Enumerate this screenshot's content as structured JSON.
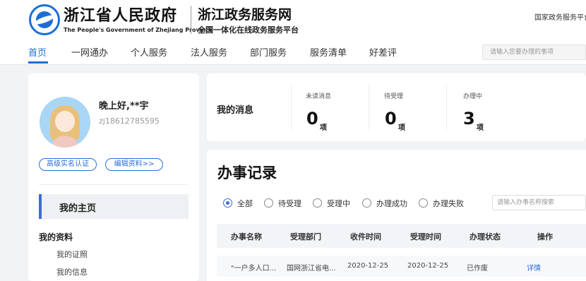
{
  "header": {
    "gov_name_cn": "浙江省人民政府",
    "gov_name_en": "The People's Government of Zhejiang Province",
    "site_name": "浙江政务服务网",
    "site_subtitle": "全国一体化在线政务服务平台",
    "national_link": "国家政务服务平台"
  },
  "nav": {
    "items": [
      "首页",
      "一网通办",
      "个人服务",
      "法人服务",
      "部门服务",
      "服务清单",
      "好差评"
    ],
    "active_index": 0,
    "search_placeholder": "请输入您要办理的事项"
  },
  "profile": {
    "greeting": "晚上好,**宇",
    "username": "zj18612785595",
    "verify_button": "高级实名认证",
    "edit_button": "编辑资料>>",
    "home_label": "我的主页",
    "my_data_label": "我的资料",
    "sub_items": [
      "我的证照",
      "我的信息"
    ]
  },
  "messages": {
    "title": "我的消息",
    "stats": [
      {
        "label": "未读消息",
        "value": "0",
        "unit": "项"
      },
      {
        "label": "待受理",
        "value": "0",
        "unit": "项"
      },
      {
        "label": "办理中",
        "value": "3",
        "unit": "项"
      }
    ]
  },
  "records": {
    "title": "办事记录",
    "filters": [
      "全部",
      "待受理",
      "受理中",
      "办理成功",
      "办理失败"
    ],
    "selected_filter": "全部",
    "search_placeholder": "请输入办事名称搜索",
    "columns": [
      "办事名称",
      "受理部门",
      "收件时间",
      "受理时间",
      "办理状态",
      "操作"
    ],
    "rows": [
      {
        "name": "\"一户多人口...",
        "dept": "国网浙江省电...",
        "received": "2020-12-25",
        "accepted": "2020-12-25",
        "status": "已作废",
        "action": "详情"
      }
    ]
  },
  "colors": {
    "accent": "#1e6fd4",
    "page_background": "#f2f3f5"
  }
}
